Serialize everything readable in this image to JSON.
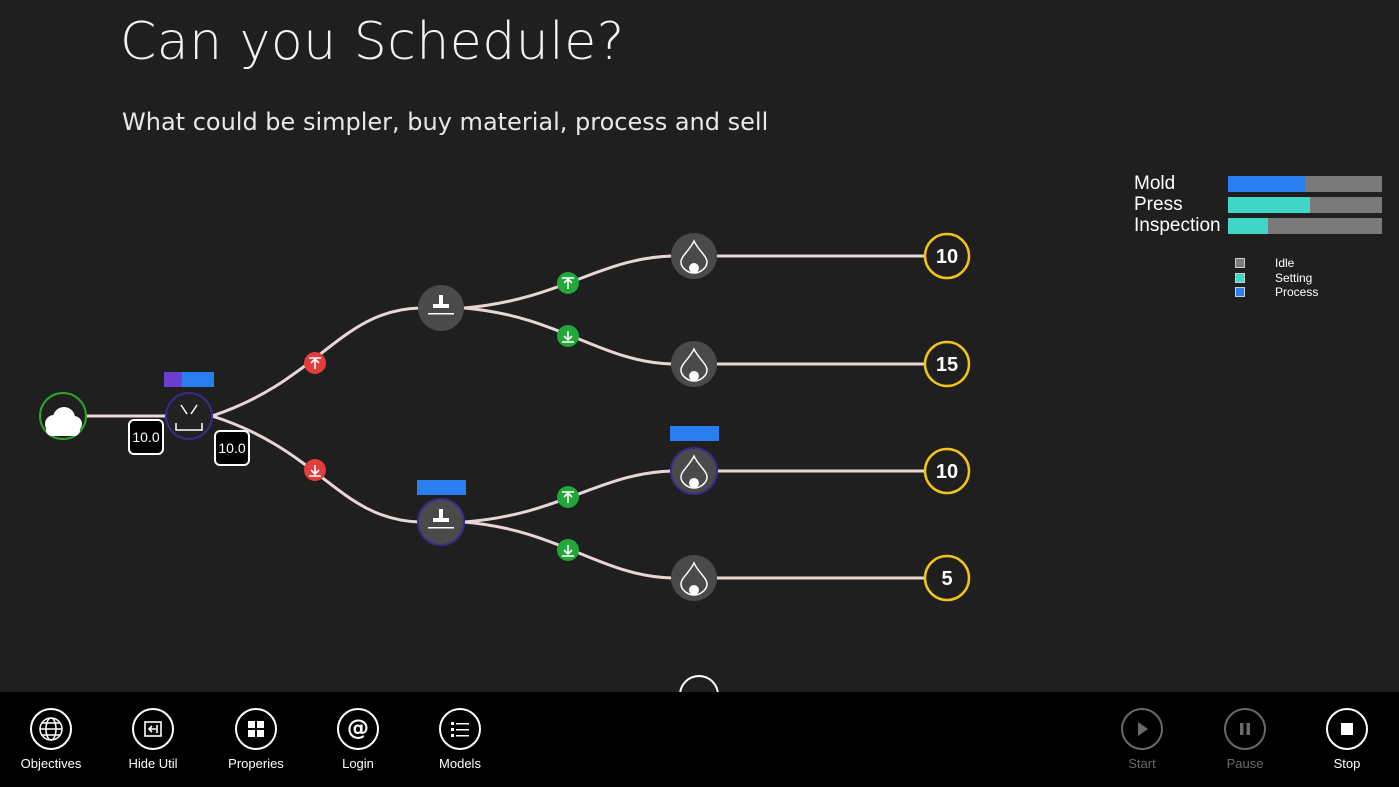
{
  "header": {
    "title": "Can you Schedule?",
    "subtitle": "What could be simpler, buy material, process and sell"
  },
  "colors": {
    "background": "#1f1f1f",
    "connector": "#e8d6d6",
    "node_fill": "#4a4a4a",
    "node_outline_active": "#3a2a8a",
    "source_ring": "#2aa52a",
    "sink_ring": "#f0c419",
    "upgrade_badge": "#e23c3c",
    "route_badge": "#22a83a",
    "idle": "#7a7a7a",
    "setting": "#3fd6c8",
    "process": "#2a7ef0",
    "setting_purple": "#6a3fd0"
  },
  "diagram": {
    "source": {
      "icon": "cloud-icon"
    },
    "buffer_in": "10.0",
    "buffer_out": "10.0",
    "mold": {
      "icon": "mold-icon"
    },
    "presses": [
      {
        "icon": "press-icon",
        "busy": false
      },
      {
        "icon": "press-icon",
        "busy": true
      }
    ],
    "inspections": [
      {
        "icon": "drop-icon",
        "busy": false
      },
      {
        "icon": "drop-icon",
        "busy": false
      },
      {
        "icon": "drop-icon",
        "busy": true
      },
      {
        "icon": "drop-icon",
        "busy": false
      }
    ],
    "sinks": [
      "10",
      "15",
      "10",
      "5"
    ]
  },
  "utilization": {
    "resources": [
      {
        "name": "Mold",
        "setting": 0.0,
        "process": 0.5
      },
      {
        "name": "Press",
        "setting": 0.53,
        "process": 0.0
      },
      {
        "name": "Inspection",
        "setting": 0.26,
        "process": 0.0
      }
    ],
    "legend": [
      {
        "label": "Idle",
        "color": "#7a7a7a"
      },
      {
        "label": "Setting",
        "color": "#3fd6c8"
      },
      {
        "label": "Process",
        "color": "#2a7ef0"
      }
    ]
  },
  "appbar": {
    "objectives": "Objectives",
    "hide_util": "Hide Util",
    "properties": "Properies",
    "login": "Login",
    "models": "Models",
    "start": "Start",
    "pause": "Pause",
    "stop": "Stop"
  }
}
